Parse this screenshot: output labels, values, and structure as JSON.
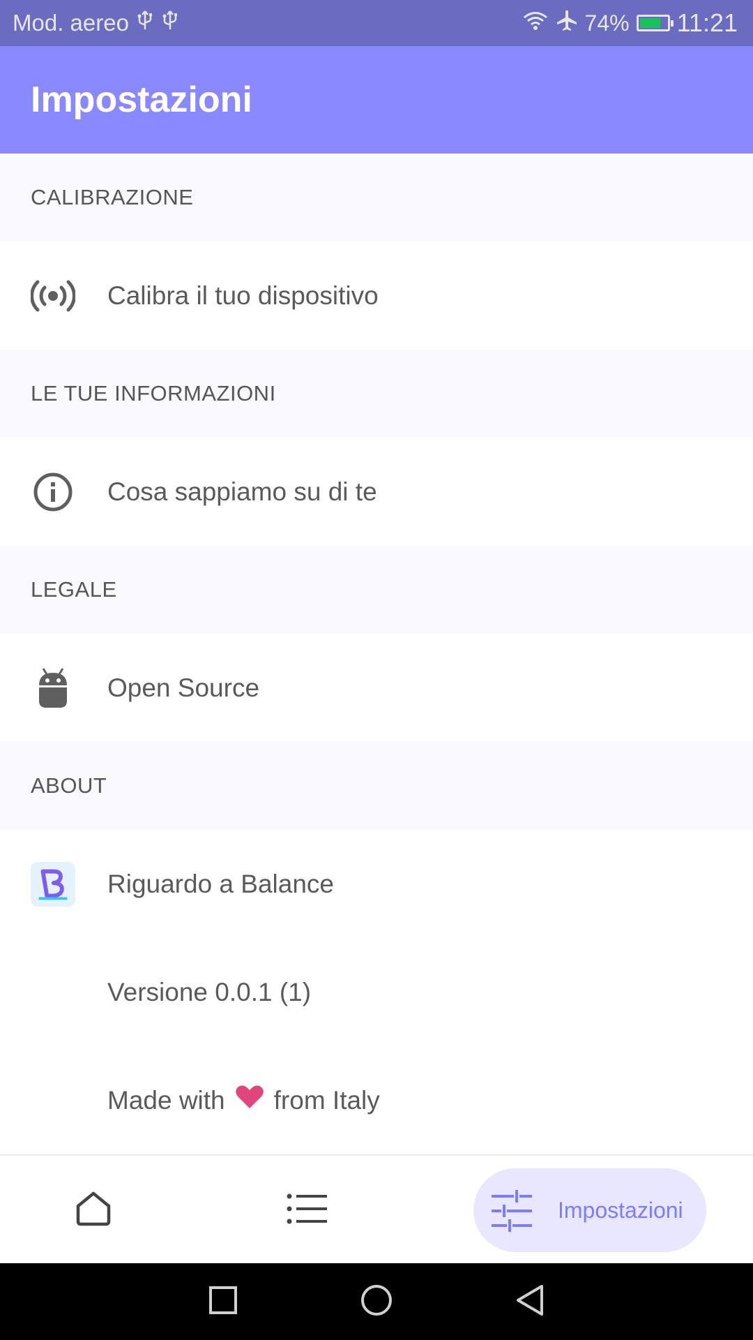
{
  "status_bar": {
    "left_text": "Mod. aereo",
    "usb_icons": [
      "usb-icon",
      "usb-icon"
    ],
    "battery_percent": "74%",
    "time": "11:21"
  },
  "app_bar": {
    "title": "Impostazioni"
  },
  "sections": [
    {
      "header": "CALIBRAZIONE",
      "items": [
        {
          "label": "Calibra il tuo dispositivo",
          "icon": "radio-broadcast-icon"
        }
      ]
    },
    {
      "header": "LE TUE INFORMAZIONI",
      "items": [
        {
          "label": "Cosa sappiamo su di te",
          "icon": "info-icon"
        }
      ]
    },
    {
      "header": "LEGALE",
      "items": [
        {
          "label": "Open Source",
          "icon": "android-icon"
        }
      ]
    },
    {
      "header": "ABOUT",
      "items": [
        {
          "label": "Riguardo a Balance",
          "icon": "app-logo-icon"
        },
        {
          "label": "Versione 0.0.1 (1)"
        },
        {
          "label_before": "Made with",
          "label_after": "from Italy",
          "icon": "heart-icon"
        }
      ]
    }
  ],
  "bottom_nav": {
    "items": [
      {
        "name": "home",
        "icon": "home-icon"
      },
      {
        "name": "list",
        "icon": "list-icon"
      },
      {
        "name": "settings",
        "icon": "tune-icon",
        "label": "Impostazioni",
        "selected": true
      }
    ]
  },
  "colors": {
    "status_bar": "#6b6bbf",
    "app_bar": "#8a88ff",
    "accent": "#7d7bff",
    "pill_bg": "#e9e7ff",
    "section_bg": "#f8f8fd",
    "heart": "#e0457b"
  }
}
